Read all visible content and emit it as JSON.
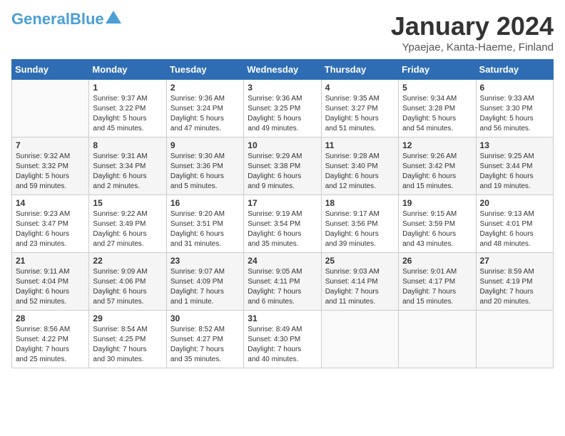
{
  "header": {
    "logo_general": "General",
    "logo_blue": "Blue",
    "title": "January 2024",
    "location": "Ypaejae, Kanta-Haeme, Finland"
  },
  "days_of_week": [
    "Sunday",
    "Monday",
    "Tuesday",
    "Wednesday",
    "Thursday",
    "Friday",
    "Saturday"
  ],
  "weeks": [
    [
      {
        "day": "",
        "info": ""
      },
      {
        "day": "1",
        "info": "Sunrise: 9:37 AM\nSunset: 3:22 PM\nDaylight: 5 hours\nand 45 minutes."
      },
      {
        "day": "2",
        "info": "Sunrise: 9:36 AM\nSunset: 3:24 PM\nDaylight: 5 hours\nand 47 minutes."
      },
      {
        "day": "3",
        "info": "Sunrise: 9:36 AM\nSunset: 3:25 PM\nDaylight: 5 hours\nand 49 minutes."
      },
      {
        "day": "4",
        "info": "Sunrise: 9:35 AM\nSunset: 3:27 PM\nDaylight: 5 hours\nand 51 minutes."
      },
      {
        "day": "5",
        "info": "Sunrise: 9:34 AM\nSunset: 3:28 PM\nDaylight: 5 hours\nand 54 minutes."
      },
      {
        "day": "6",
        "info": "Sunrise: 9:33 AM\nSunset: 3:30 PM\nDaylight: 5 hours\nand 56 minutes."
      }
    ],
    [
      {
        "day": "7",
        "info": "Sunrise: 9:32 AM\nSunset: 3:32 PM\nDaylight: 5 hours\nand 59 minutes."
      },
      {
        "day": "8",
        "info": "Sunrise: 9:31 AM\nSunset: 3:34 PM\nDaylight: 6 hours\nand 2 minutes."
      },
      {
        "day": "9",
        "info": "Sunrise: 9:30 AM\nSunset: 3:36 PM\nDaylight: 6 hours\nand 5 minutes."
      },
      {
        "day": "10",
        "info": "Sunrise: 9:29 AM\nSunset: 3:38 PM\nDaylight: 6 hours\nand 9 minutes."
      },
      {
        "day": "11",
        "info": "Sunrise: 9:28 AM\nSunset: 3:40 PM\nDaylight: 6 hours\nand 12 minutes."
      },
      {
        "day": "12",
        "info": "Sunrise: 9:26 AM\nSunset: 3:42 PM\nDaylight: 6 hours\nand 15 minutes."
      },
      {
        "day": "13",
        "info": "Sunrise: 9:25 AM\nSunset: 3:44 PM\nDaylight: 6 hours\nand 19 minutes."
      }
    ],
    [
      {
        "day": "14",
        "info": "Sunrise: 9:23 AM\nSunset: 3:47 PM\nDaylight: 6 hours\nand 23 minutes."
      },
      {
        "day": "15",
        "info": "Sunrise: 9:22 AM\nSunset: 3:49 PM\nDaylight: 6 hours\nand 27 minutes."
      },
      {
        "day": "16",
        "info": "Sunrise: 9:20 AM\nSunset: 3:51 PM\nDaylight: 6 hours\nand 31 minutes."
      },
      {
        "day": "17",
        "info": "Sunrise: 9:19 AM\nSunset: 3:54 PM\nDaylight: 6 hours\nand 35 minutes."
      },
      {
        "day": "18",
        "info": "Sunrise: 9:17 AM\nSunset: 3:56 PM\nDaylight: 6 hours\nand 39 minutes."
      },
      {
        "day": "19",
        "info": "Sunrise: 9:15 AM\nSunset: 3:59 PM\nDaylight: 6 hours\nand 43 minutes."
      },
      {
        "day": "20",
        "info": "Sunrise: 9:13 AM\nSunset: 4:01 PM\nDaylight: 6 hours\nand 48 minutes."
      }
    ],
    [
      {
        "day": "21",
        "info": "Sunrise: 9:11 AM\nSunset: 4:04 PM\nDaylight: 6 hours\nand 52 minutes."
      },
      {
        "day": "22",
        "info": "Sunrise: 9:09 AM\nSunset: 4:06 PM\nDaylight: 6 hours\nand 57 minutes."
      },
      {
        "day": "23",
        "info": "Sunrise: 9:07 AM\nSunset: 4:09 PM\nDaylight: 7 hours\nand 1 minute."
      },
      {
        "day": "24",
        "info": "Sunrise: 9:05 AM\nSunset: 4:11 PM\nDaylight: 7 hours\nand 6 minutes."
      },
      {
        "day": "25",
        "info": "Sunrise: 9:03 AM\nSunset: 4:14 PM\nDaylight: 7 hours\nand 11 minutes."
      },
      {
        "day": "26",
        "info": "Sunrise: 9:01 AM\nSunset: 4:17 PM\nDaylight: 7 hours\nand 15 minutes."
      },
      {
        "day": "27",
        "info": "Sunrise: 8:59 AM\nSunset: 4:19 PM\nDaylight: 7 hours\nand 20 minutes."
      }
    ],
    [
      {
        "day": "28",
        "info": "Sunrise: 8:56 AM\nSunset: 4:22 PM\nDaylight: 7 hours\nand 25 minutes."
      },
      {
        "day": "29",
        "info": "Sunrise: 8:54 AM\nSunset: 4:25 PM\nDaylight: 7 hours\nand 30 minutes."
      },
      {
        "day": "30",
        "info": "Sunrise: 8:52 AM\nSunset: 4:27 PM\nDaylight: 7 hours\nand 35 minutes."
      },
      {
        "day": "31",
        "info": "Sunrise: 8:49 AM\nSunset: 4:30 PM\nDaylight: 7 hours\nand 40 minutes."
      },
      {
        "day": "",
        "info": ""
      },
      {
        "day": "",
        "info": ""
      },
      {
        "day": "",
        "info": ""
      }
    ]
  ]
}
